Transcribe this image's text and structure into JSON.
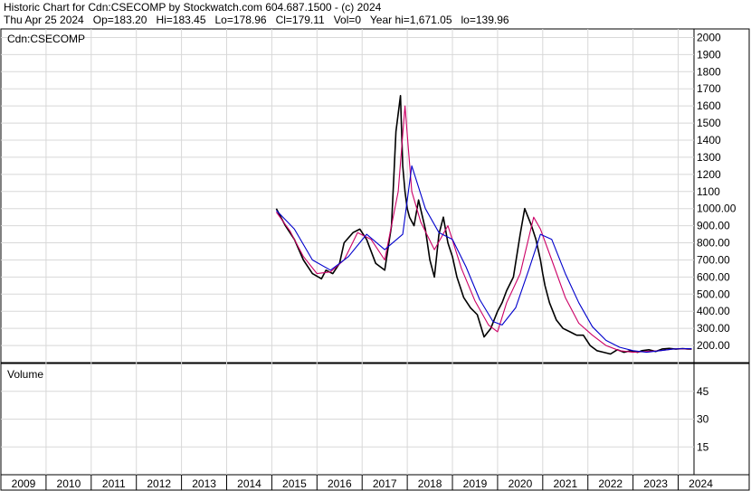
{
  "header": {
    "line1": "Historic Chart for Cdn:CSECOMP by Stockwatch.com 604.687.1500 - (c) 2024",
    "line2": "Thu Apr 25 2024   Op=183.20   Hi=183.45   Lo=178.96   Cl=179.11   Vol=0   Year hi=1,671.05   lo=139.96"
  },
  "chart_data": {
    "type": "line",
    "symbol_label": "Cdn:CSECOMP",
    "volume_label": "Volume",
    "price_axis": {
      "ylim": [
        100,
        2050
      ],
      "ticks": [
        {
          "v": 2000,
          "label": "2000"
        },
        {
          "v": 1900,
          "label": "1900"
        },
        {
          "v": 1800,
          "label": "1800"
        },
        {
          "v": 1700,
          "label": "1700"
        },
        {
          "v": 1600,
          "label": "1600"
        },
        {
          "v": 1500,
          "label": "1500"
        },
        {
          "v": 1400,
          "label": "1400"
        },
        {
          "v": 1300,
          "label": "1300"
        },
        {
          "v": 1200,
          "label": "1200"
        },
        {
          "v": 1100,
          "label": "1100"
        },
        {
          "v": 1000,
          "label": "1000.00"
        },
        {
          "v": 900,
          "label": "900.00"
        },
        {
          "v": 800,
          "label": "800.00"
        },
        {
          "v": 700,
          "label": "700.00"
        },
        {
          "v": 600,
          "label": "600.00"
        },
        {
          "v": 500,
          "label": "500.00"
        },
        {
          "v": 400,
          "label": "400.00"
        },
        {
          "v": 300,
          "label": "300.00"
        },
        {
          "v": 200,
          "label": "200.00"
        }
      ]
    },
    "volume_axis": {
      "ylim": [
        0,
        60
      ],
      "ticks": [
        {
          "v": 45,
          "label": "45"
        },
        {
          "v": 30,
          "label": "30"
        },
        {
          "v": 15,
          "label": "15"
        }
      ]
    },
    "x_axis": {
      "xlim": [
        2009.0,
        2024.35
      ],
      "years": [
        "2009",
        "2010",
        "2011",
        "2012",
        "2013",
        "2014",
        "2015",
        "2016",
        "2017",
        "2018",
        "2019",
        "2020",
        "2021",
        "2022",
        "2023",
        "2024"
      ]
    },
    "series": [
      {
        "color": "#000000",
        "x": [
          2015.1,
          2015.3,
          2015.5,
          2015.7,
          2015.9,
          2016.1,
          2016.2,
          2016.35,
          2016.5,
          2016.6,
          2016.8,
          2016.95,
          2017.1,
          2017.3,
          2017.5,
          2017.65,
          2017.75,
          2017.85,
          2017.9,
          2017.95,
          2018.0,
          2018.05,
          2018.15,
          2018.25,
          2018.4,
          2018.5,
          2018.6,
          2018.7,
          2018.8,
          2018.9,
          2019.0,
          2019.1,
          2019.25,
          2019.4,
          2019.55,
          2019.7,
          2019.85,
          2020.0,
          2020.1,
          2020.2,
          2020.35,
          2020.5,
          2020.6,
          2020.75,
          2020.85,
          2020.95,
          2021.0,
          2021.05,
          2021.15,
          2021.3,
          2021.45,
          2021.6,
          2021.75,
          2021.9,
          2022.05,
          2022.2,
          2022.35,
          2022.5,
          2022.65,
          2022.8,
          2022.95,
          2023.1,
          2023.2,
          2023.35,
          2023.5,
          2023.65,
          2023.8,
          2023.95,
          2024.1,
          2024.2,
          2024.3
        ],
        "values": [
          1000,
          900,
          820,
          700,
          620,
          590,
          640,
          620,
          680,
          800,
          860,
          880,
          820,
          680,
          640,
          900,
          1450,
          1660,
          1250,
          1100,
          1000,
          950,
          900,
          1050,
          880,
          700,
          600,
          850,
          950,
          800,
          720,
          600,
          480,
          420,
          380,
          250,
          300,
          400,
          450,
          520,
          600,
          850,
          1000,
          900,
          820,
          700,
          620,
          550,
          450,
          350,
          300,
          280,
          260,
          260,
          200,
          170,
          160,
          150,
          175,
          160,
          170,
          160,
          170,
          175,
          165,
          180,
          183,
          179,
          182,
          180,
          179
        ]
      },
      {
        "color": "#cc0066",
        "x": [
          2015.1,
          2015.4,
          2015.7,
          2016.0,
          2016.3,
          2016.6,
          2016.9,
          2017.2,
          2017.5,
          2017.8,
          2017.95,
          2018.1,
          2018.3,
          2018.6,
          2018.9,
          2019.2,
          2019.5,
          2019.8,
          2020.0,
          2020.2,
          2020.5,
          2020.8,
          2020.95,
          2021.2,
          2021.5,
          2021.8,
          2022.1,
          2022.4,
          2022.7,
          2023.0,
          2023.3,
          2023.6,
          2023.9,
          2024.2,
          2024.3
        ],
        "values": [
          980,
          870,
          720,
          620,
          630,
          700,
          860,
          820,
          700,
          1100,
          1600,
          1100,
          920,
          760,
          900,
          650,
          460,
          320,
          280,
          450,
          620,
          950,
          880,
          700,
          480,
          330,
          260,
          200,
          170,
          160,
          165,
          170,
          180,
          181,
          180
        ]
      },
      {
        "color": "#0000cc",
        "x": [
          2015.1,
          2015.5,
          2015.9,
          2016.3,
          2016.7,
          2017.1,
          2017.5,
          2017.9,
          2018.1,
          2018.4,
          2018.7,
          2019.0,
          2019.3,
          2019.6,
          2019.9,
          2020.1,
          2020.4,
          2020.7,
          2020.95,
          2021.2,
          2021.5,
          2021.8,
          2022.1,
          2022.4,
          2022.7,
          2023.0,
          2023.3,
          2023.6,
          2023.9,
          2024.2,
          2024.3
        ],
        "values": [
          990,
          880,
          700,
          640,
          720,
          850,
          760,
          850,
          1250,
          1000,
          860,
          820,
          660,
          470,
          340,
          320,
          420,
          650,
          850,
          820,
          620,
          450,
          310,
          230,
          190,
          170,
          160,
          170,
          180,
          182,
          181
        ]
      }
    ]
  }
}
